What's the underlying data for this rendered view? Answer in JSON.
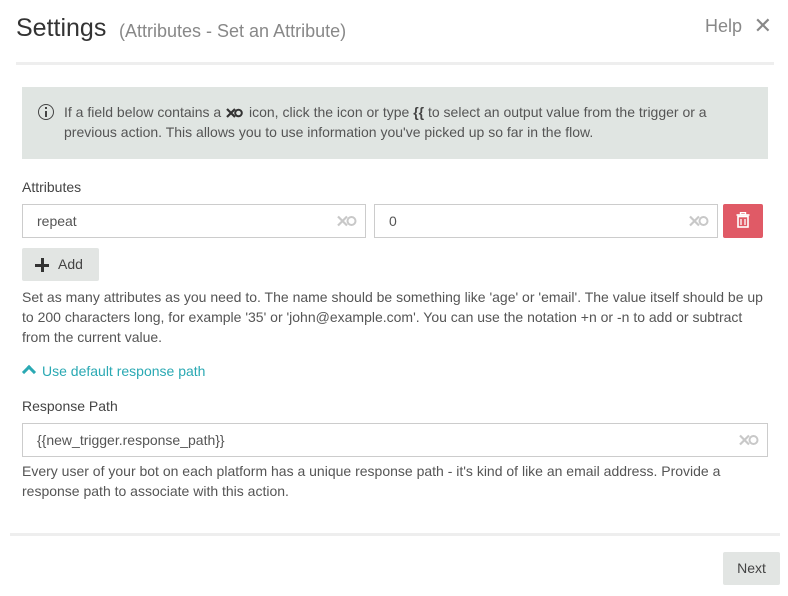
{
  "header": {
    "title": "Settings",
    "subtitle": "(Attributes - Set an Attribute)",
    "help_label": "Help",
    "close_glyph": "✕"
  },
  "info": {
    "text_1": "If a field below contains a",
    "text_2": "icon, click the icon or type",
    "braces": "{{",
    "text_3": "to select an output value from the trigger or a previous action. This allows you to use information you've picked up so far in the flow.",
    "icon": "info-circle-icon",
    "inline_icon": "variable-picker-icon"
  },
  "attributes": {
    "label": "Attributes",
    "rows": [
      {
        "name": "repeat",
        "value": "0"
      }
    ],
    "add_label": "Add",
    "help": "Set as many attributes as you need to. The name should be something like 'age' or 'email'. The value itself should be up to 200 characters long, for example '35' or 'john@example.com'. You can use the notation +n or -n to add or subtract from the current value."
  },
  "response": {
    "toggle_label": "Use default response path",
    "label": "Response Path",
    "value": "{{new_trigger.response_path}}",
    "help": "Every user of your bot on each platform has a unique response path - it's kind of like an email address. Provide a response path to associate with this action."
  },
  "footer": {
    "next_label": "Next"
  },
  "colors": {
    "accent": "#2aa9b3",
    "danger": "#e05a66",
    "info_bg": "#e0e5e2",
    "button_bg": "#e2e5e3"
  }
}
